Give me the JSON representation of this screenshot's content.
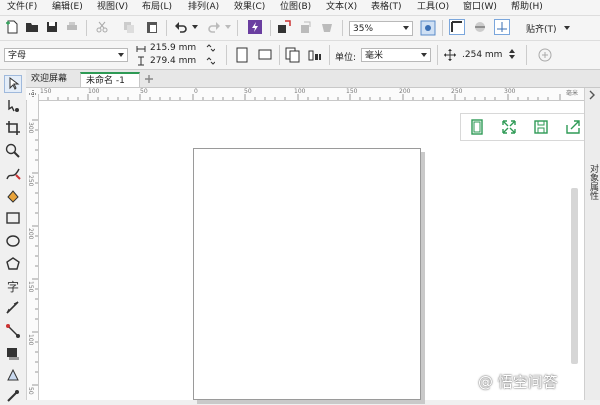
{
  "menu": [
    "文件(F)",
    "编辑(E)",
    "视图(V)",
    "布局(L)",
    "排列(A)",
    "效果(C)",
    "位图(B)",
    "文本(X)",
    "表格(T)",
    "工具(O)",
    "窗口(W)",
    "帮助(H)"
  ],
  "toolbar": {
    "zoom": "35%",
    "snap_label": "贴齐(T)"
  },
  "propbar": {
    "paper_preset": "字母",
    "width": "215.9 mm",
    "height": "279.4 mm",
    "units_label": "单位:",
    "units_value": "毫米",
    "nudge": ".254 mm"
  },
  "tabs": {
    "welcome": "欢迎屏幕",
    "document": "未命名 -1"
  },
  "rulers": {
    "h_ticks": [
      "150",
      "100",
      "50",
      "0",
      "50",
      "100",
      "150",
      "200",
      "250",
      "300"
    ],
    "h_unit": "毫米",
    "v_ticks": [
      "300",
      "250",
      "200",
      "150",
      "100",
      "50"
    ]
  },
  "right_panel": {
    "label": "对象属性"
  },
  "watermark": "@ 悟空问答",
  "colors": {
    "accent_green": "#2e9a55",
    "menu_bg": "#f5f5f5",
    "canvas_bg": "#ffffff",
    "page_shadow": "#c9c9c9"
  }
}
